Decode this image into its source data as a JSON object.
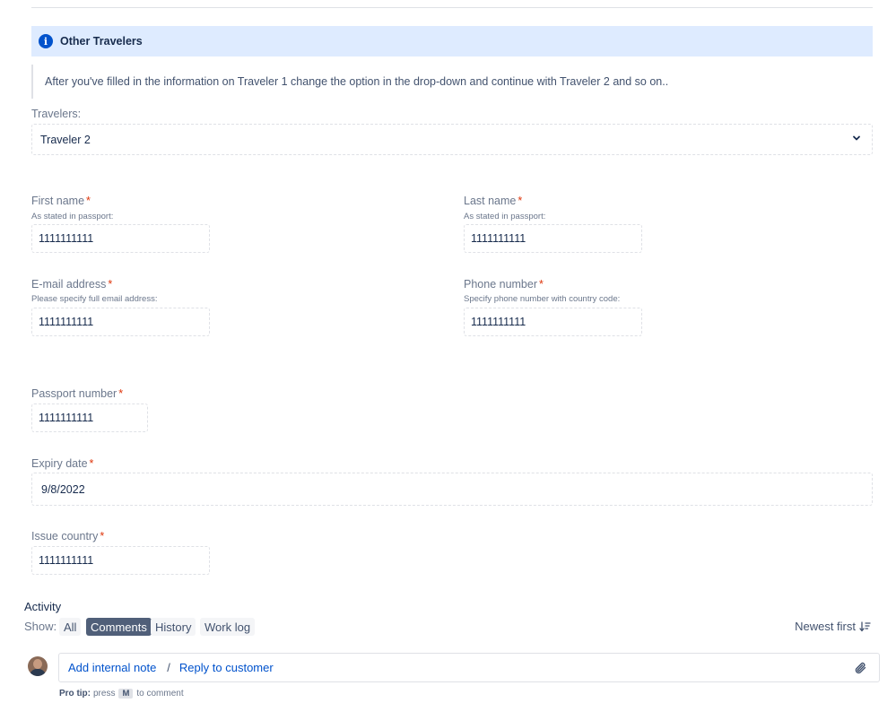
{
  "info_panel": {
    "title": "Other Travelers",
    "icon": "info-icon"
  },
  "instructions": "After you've filled in the information on Traveler 1 change the option in the drop-down and continue with Traveler 2 and so on..",
  "travelers": {
    "label": "Travelers:",
    "selected": "Traveler 2"
  },
  "fields": {
    "first_name": {
      "label": "First name",
      "required": "*",
      "help": "As stated in passport:",
      "value": "1111111111"
    },
    "last_name": {
      "label": "Last name",
      "required": "*",
      "help": "As stated in passport:",
      "value": "1111111111"
    },
    "email": {
      "label": "E-mail address",
      "required": "*",
      "help": "Please specify full email address:",
      "value": "1111111111"
    },
    "phone": {
      "label": "Phone number",
      "required": "*",
      "help": "Specify phone number with country code:",
      "value": "1111111111"
    },
    "passport": {
      "label": "Passport number",
      "required": "*",
      "value": "1111111111"
    },
    "expiry": {
      "label": "Expiry date",
      "required": "*",
      "value": "9/8/2022"
    },
    "issue_country": {
      "label": "Issue country",
      "required": "*",
      "value": "1111111111"
    }
  },
  "activity": {
    "title": "Activity",
    "show_label": "Show:",
    "filters": [
      "All",
      "Comments",
      "History",
      "Work log"
    ],
    "active_filter": "Comments",
    "sort_label": "Newest first"
  },
  "comment": {
    "internal_note": "Add internal note",
    "separator": "/",
    "reply": "Reply to customer"
  },
  "protip": {
    "prefix": "Pro tip:",
    "press": "press",
    "key": "M",
    "suffix": "to comment"
  },
  "colors": {
    "accent": "#0052cc",
    "required": "#de350b",
    "info_bg": "#deebff",
    "active_filter_bg": "#505f79"
  }
}
